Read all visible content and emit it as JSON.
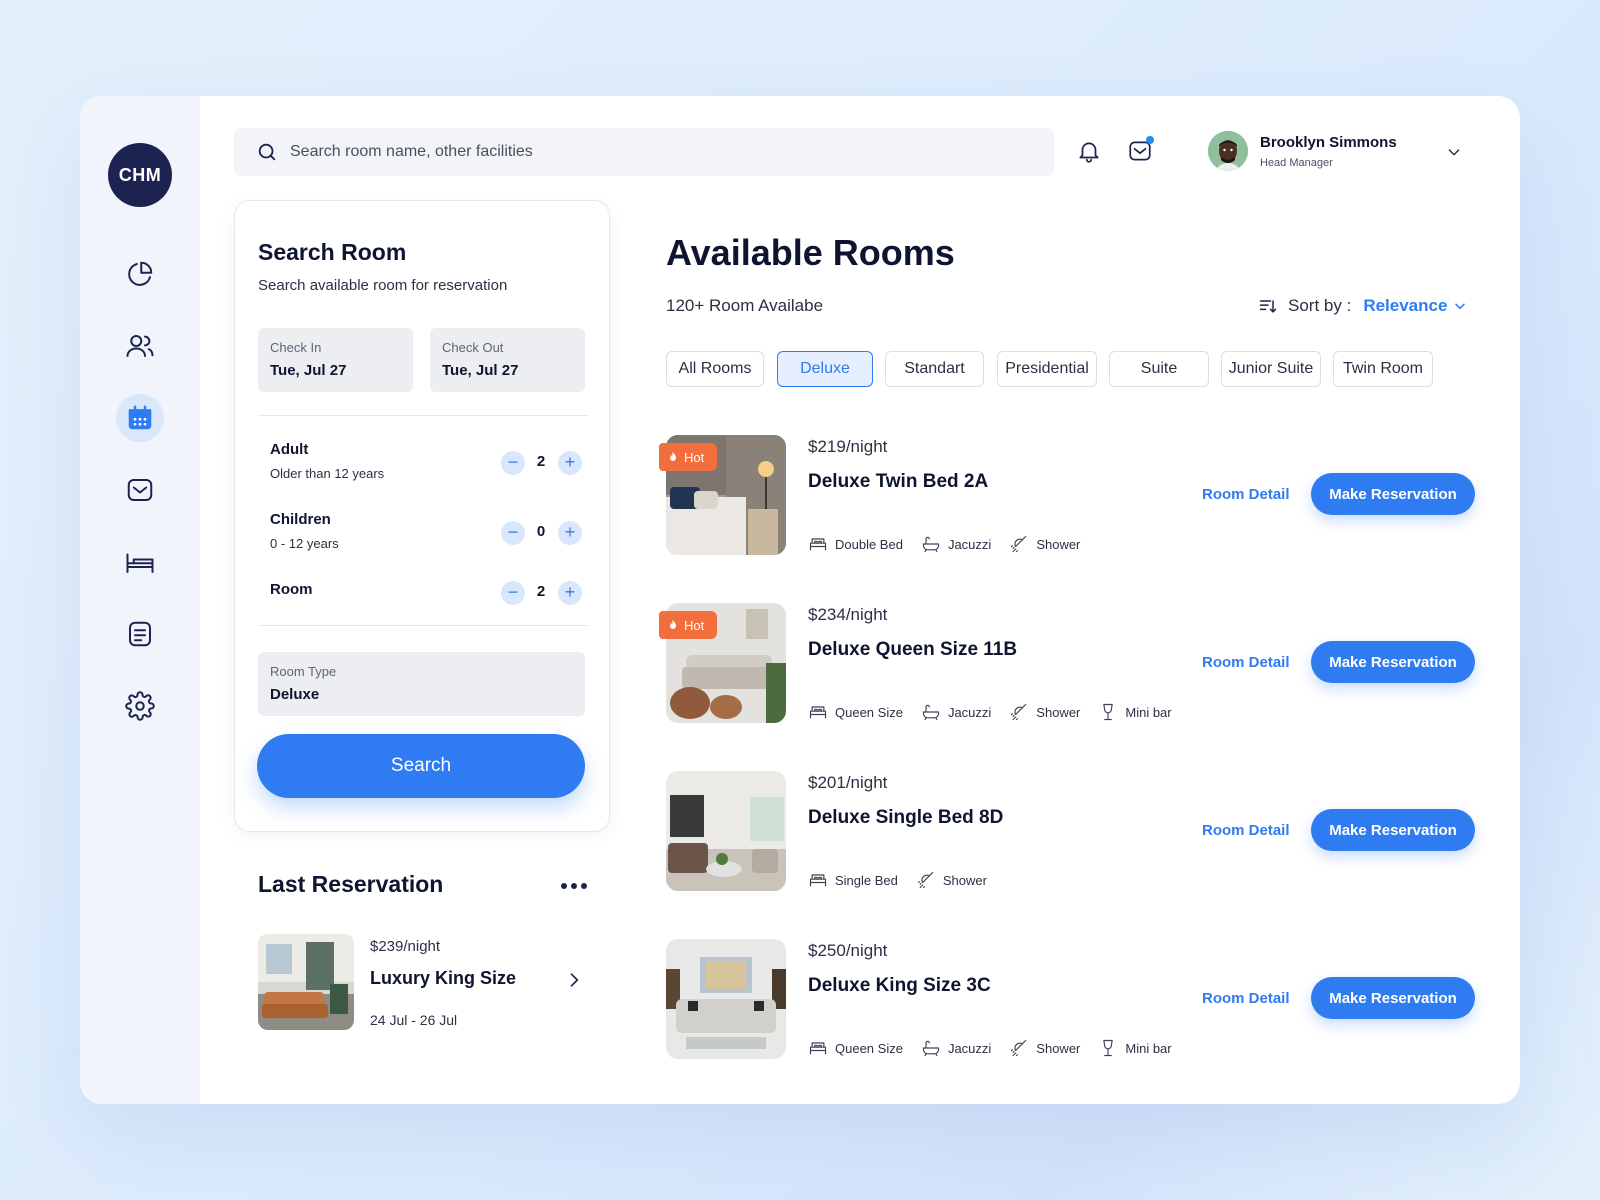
{
  "brand": {
    "logo_text": "CHM"
  },
  "sidebar": {
    "items": [
      {
        "name": "dashboard",
        "icon": "pie-chart-icon",
        "active": false
      },
      {
        "name": "guests",
        "icon": "users-icon",
        "active": false
      },
      {
        "name": "reservations",
        "icon": "calendar-icon",
        "active": true
      },
      {
        "name": "messages",
        "icon": "inbox-icon",
        "active": false
      },
      {
        "name": "rooms",
        "icon": "bed-icon",
        "active": false
      },
      {
        "name": "reports",
        "icon": "document-icon",
        "active": false
      },
      {
        "name": "settings",
        "icon": "gear-icon",
        "active": false
      }
    ]
  },
  "topbar": {
    "search_placeholder": "Search room name, other facilities",
    "user": {
      "name": "Brooklyn Simmons",
      "role": "Head Manager"
    }
  },
  "search_room": {
    "title": "Search Room",
    "subtitle": "Search available room for reservation",
    "check_in": {
      "label": "Check In",
      "value": "Tue, Jul 27"
    },
    "check_out": {
      "label": "Check Out",
      "value": "Tue, Jul 27"
    },
    "adult": {
      "label": "Adult",
      "sub": "Older than 12 years",
      "value": "2"
    },
    "children": {
      "label": "Children",
      "sub": "0 - 12 years",
      "value": "0"
    },
    "room": {
      "label": "Room",
      "value": "2"
    },
    "room_type": {
      "label": "Room Type",
      "value": "Deluxe"
    },
    "search_label": "Search",
    "minus": "−",
    "plus": "+"
  },
  "last_reservation": {
    "title": "Last Reservation",
    "price": "$239/night",
    "name": "Luxury King Size",
    "dates": "24 Jul - 26 Jul"
  },
  "available": {
    "title": "Available Rooms",
    "count": "120+ Room Availabe",
    "sort_label": "Sort by :",
    "sort_value": "Relevance",
    "tabs": [
      "All Rooms",
      "Deluxe",
      "Standart",
      "Presidential",
      "Suite",
      "Junior Suite",
      "Twin Room"
    ],
    "active_tab": "Deluxe",
    "hot_label": "Hot",
    "room_detail_label": "Room Detail",
    "reserve_label": "Make Reservation",
    "rooms": [
      {
        "price": "$219/night",
        "name": "Deluxe Twin Bed 2A",
        "hot": true,
        "amenities": [
          {
            "icon": "bed-icon",
            "label": "Double Bed"
          },
          {
            "icon": "bathtub-icon",
            "label": "Jacuzzi"
          },
          {
            "icon": "shower-icon",
            "label": "Shower"
          }
        ]
      },
      {
        "price": "$234/night",
        "name": "Deluxe Queen Size 11B",
        "hot": true,
        "amenities": [
          {
            "icon": "bed-icon",
            "label": "Queen Size"
          },
          {
            "icon": "bathtub-icon",
            "label": "Jacuzzi"
          },
          {
            "icon": "shower-icon",
            "label": "Shower"
          },
          {
            "icon": "wine-glass-icon",
            "label": "Mini bar"
          }
        ]
      },
      {
        "price": "$201/night",
        "name": "Deluxe Single Bed 8D",
        "hot": false,
        "amenities": [
          {
            "icon": "bed-icon",
            "label": "Single Bed"
          },
          {
            "icon": "shower-icon",
            "label": "Shower"
          }
        ]
      },
      {
        "price": "$250/night",
        "name": "Deluxe King Size 3C",
        "hot": false,
        "amenities": [
          {
            "icon": "bed-icon",
            "label": "Queen Size"
          },
          {
            "icon": "bathtub-icon",
            "label": "Jacuzzi"
          },
          {
            "icon": "shower-icon",
            "label": "Shower"
          },
          {
            "icon": "wine-glass-icon",
            "label": "Mini bar"
          }
        ]
      }
    ]
  },
  "colors": {
    "accent": "#2f7bf2",
    "navy": "#1c2350",
    "hot": "#f26f3d",
    "sidebar_bg": "#f1f5fb"
  }
}
